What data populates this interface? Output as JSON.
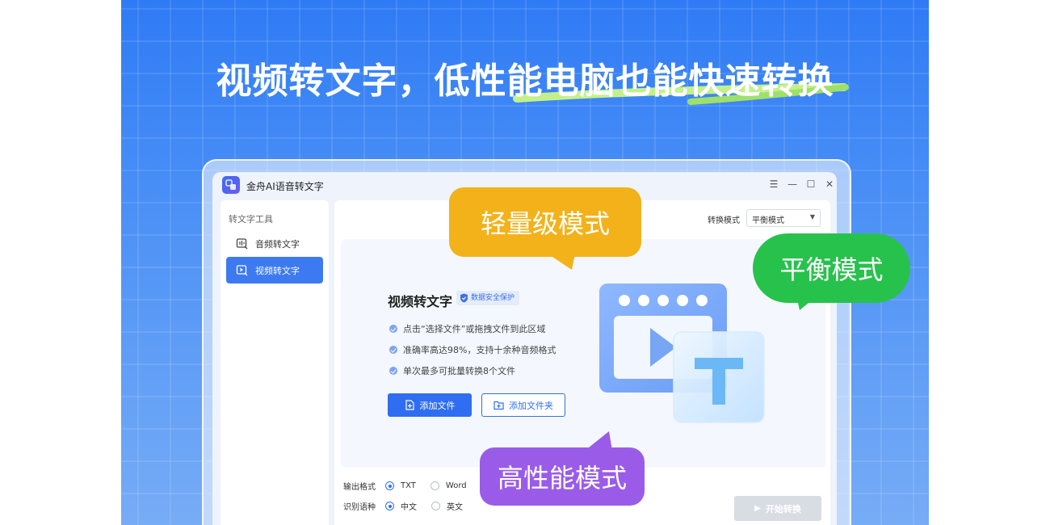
{
  "headline": {
    "text": "视频转文字，低性能电脑也能快速转换"
  },
  "app": {
    "title": "金舟AI语音转文字",
    "window_controls": [
      "menu-icon",
      "minimize-icon",
      "maximize-icon",
      "close-icon"
    ]
  },
  "sidebar": {
    "title": "转文字工具",
    "items": [
      {
        "label": "音频转文字",
        "icon": "audio-icon",
        "active": false
      },
      {
        "label": "视频转文字",
        "icon": "video-icon",
        "active": true
      }
    ]
  },
  "main": {
    "mode_label": "转换模式",
    "mode_value": "平衡模式",
    "dropzone": {
      "title": "视频转文字",
      "badge": "数据安全保护",
      "features": [
        "点击“选择文件”或拖拽文件到此区域",
        "准确率高达98%，支持十余种音频格式",
        "单次最多可批量转换8个文件"
      ],
      "add_file": "添加文件",
      "add_folder": "添加文件夹"
    },
    "output_format": {
      "label": "输出格式",
      "options": [
        "TXT",
        "Word"
      ],
      "selected": "TXT"
    },
    "language": {
      "label": "识别语种",
      "options": [
        "中文",
        "英文"
      ],
      "selected": "中文"
    },
    "start_button": "开始转换"
  },
  "bubbles": {
    "light": "轻量级模式",
    "balanced": "平衡模式",
    "high": "高性能模式"
  },
  "colors": {
    "brand_blue": "#2f6ef0",
    "bubble_yellow": "#f3b21a",
    "bubble_green": "#27c24c",
    "bubble_purple": "#9a5ce8",
    "underline_green": "#b8ee7a"
  }
}
